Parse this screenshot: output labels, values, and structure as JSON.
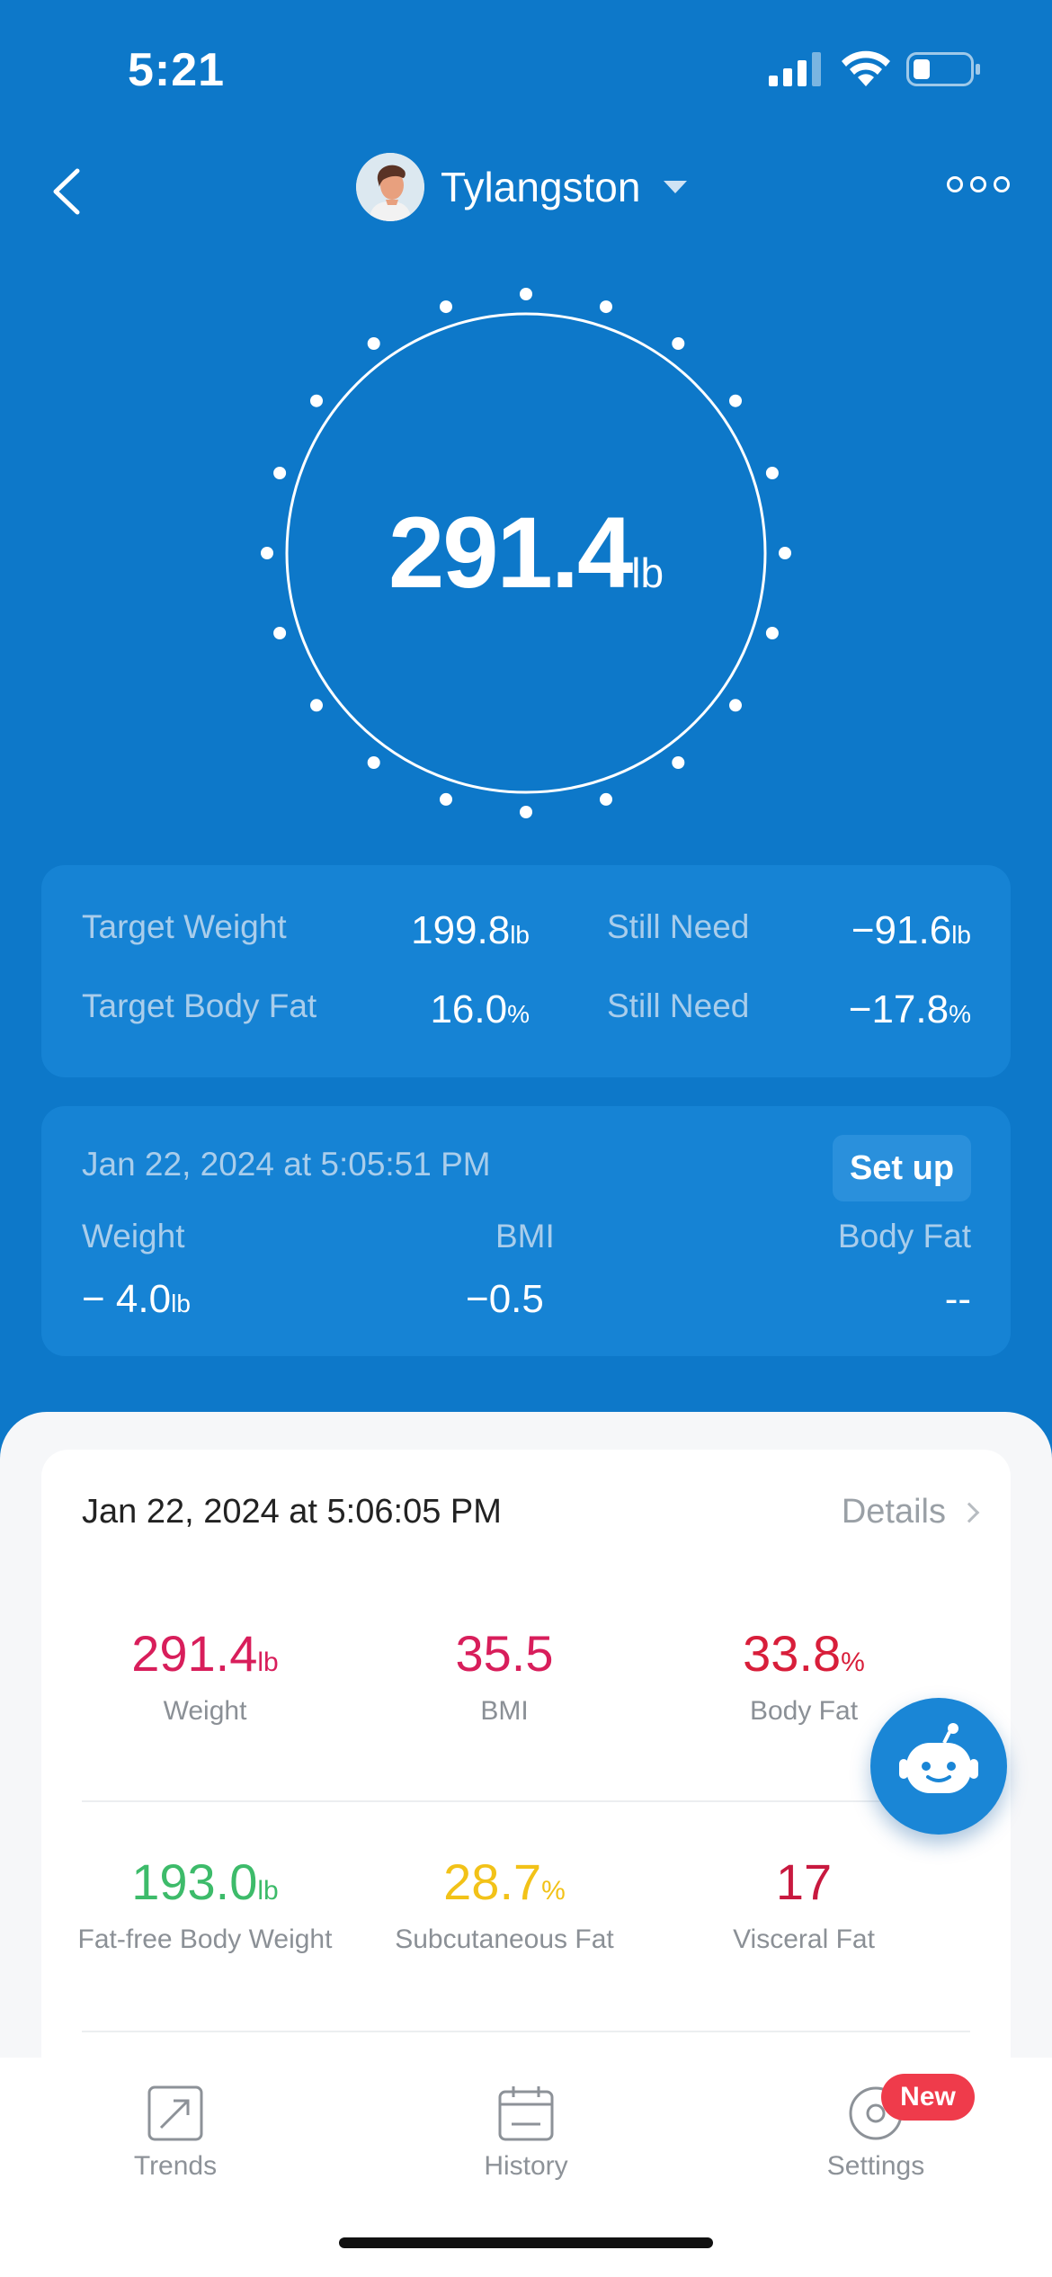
{
  "status_bar": {
    "time": "5:21"
  },
  "header": {
    "username": "Tylangston"
  },
  "current": {
    "weight": "291.4",
    "unit": "lb"
  },
  "targets": {
    "target_weight_label": "Target Weight",
    "target_weight_value": "199.8",
    "target_weight_unit": "lb",
    "still_need_label": "Still Need",
    "still_need_weight": "−91.6",
    "still_need_weight_unit": "lb",
    "target_fat_label": "Target Body Fat",
    "target_fat_value": "16.0",
    "target_fat_unit": "%",
    "still_need_fat": "−17.8",
    "still_need_fat_unit": "%"
  },
  "last_change": {
    "date": "Jan 22, 2024 at 5:05:51 PM",
    "setup_label": "Set up",
    "weight_label": "Weight",
    "bmi_label": "BMI",
    "bodyfat_label": "Body Fat",
    "weight_value": "− 4.0",
    "weight_unit": "lb",
    "bmi_value": "−0.5",
    "bodyfat_value": "--"
  },
  "measurement": {
    "date": "Jan 22, 2024 at 5:06:05 PM",
    "details_label": "Details",
    "metrics": [
      {
        "value": "291.4",
        "unit": "lb",
        "label": "Weight",
        "color": "#d81e5b"
      },
      {
        "value": "35.5",
        "unit": "",
        "label": "BMI",
        "color": "#d81e5b"
      },
      {
        "value": "33.8",
        "unit": "%",
        "label": "Body Fat",
        "color": "#d81e3a"
      },
      {
        "value": "193.0",
        "unit": "lb",
        "label": "Fat-free Body Weight",
        "color": "#3dbb6a"
      },
      {
        "value": "28.7",
        "unit": "%",
        "label": "Subcutaneous Fat",
        "color": "#f2c218"
      },
      {
        "value": "17",
        "unit": "",
        "label": "Visceral Fat",
        "color": "#c8193f"
      }
    ]
  },
  "tabs": [
    {
      "label": "Trends",
      "icon": "trend-arrow-icon"
    },
    {
      "label": "History",
      "icon": "calendar-icon"
    },
    {
      "label": "Settings",
      "icon": "settings-icon"
    }
  ],
  "badge": "New",
  "colors": {
    "brand_blue": "#0d78c9",
    "card_blue": "#1683d4",
    "badge_red": "#ef3b4b"
  }
}
